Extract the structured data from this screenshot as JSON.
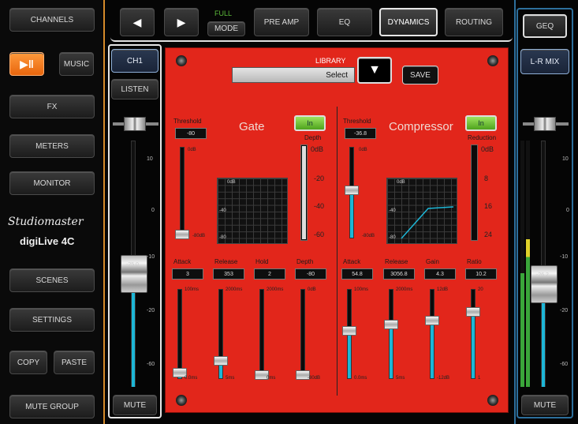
{
  "left_nav": {
    "channels": "CHANNELS",
    "music": "MUSIC",
    "fx": "FX",
    "meters": "METERS",
    "monitor": "MONITOR",
    "brand": "Studiomaster",
    "model": "digiLive 4C",
    "scenes": "SCENES",
    "settings": "SETTINGS",
    "copy": "COPY",
    "paste": "PASTE",
    "mute_group": "MUTE GROUP"
  },
  "top_bar": {
    "full": "FULL",
    "mode": "MODE",
    "tabs": [
      "PRE AMP",
      "EQ",
      "DYNAMICS",
      "ROUTING"
    ],
    "selected_tab": "DYNAMICS"
  },
  "channel_strip": {
    "channel": "CH1",
    "listen": "LISTEN",
    "fader_value": "-25.0",
    "scale": [
      "10",
      "0",
      "-10",
      "-20",
      "-60"
    ],
    "mute": "MUTE",
    "level": 0.45
  },
  "right_strip": {
    "geq": "GEQ",
    "bus": "L-R MIX",
    "fader_value": "-26.2",
    "scale": [
      "10",
      "0",
      "-10",
      "-20",
      "-60"
    ],
    "mute": "MUTE",
    "level": 0.4
  },
  "library": {
    "label": "LIBRARY",
    "select": "Select",
    "save": "SAVE"
  },
  "gate": {
    "title": "Gate",
    "in_label": "In",
    "threshold_label": "Threshold",
    "threshold_value": "-80",
    "threshold_top": "0dB",
    "threshold_bottom": "-80dB",
    "threshold_level": 0.0,
    "depth_label": "Depth",
    "depth_scale": [
      "0dB",
      "-20",
      "-40",
      "-60"
    ],
    "depth_level": 1.0,
    "graph_top": "0dB",
    "graph_mid": "-40",
    "graph_bottom": "-80",
    "knobs": [
      {
        "label": "Attack",
        "value": "3",
        "top": "100ms",
        "bottom": "0.0ms",
        "level": 0.03
      },
      {
        "label": "Release",
        "value": "353",
        "top": "2000ms",
        "bottom": "5ms",
        "level": 0.18
      },
      {
        "label": "Hold",
        "value": "2",
        "top": "2000ms",
        "bottom": "0ms",
        "level": 0.0
      },
      {
        "label": "Depth",
        "value": "-80",
        "top": "0dB",
        "bottom": "-80dB",
        "level": 0.0
      }
    ]
  },
  "compressor": {
    "title": "Compressor",
    "in_label": "In",
    "threshold_label": "Threshold",
    "threshold_value": "-36.8",
    "threshold_top": "0dB",
    "threshold_bottom": "-80dB",
    "threshold_level": 0.54,
    "reduction_label": "Reduction",
    "reduction_scale": [
      "0dB",
      "8",
      "16",
      "24"
    ],
    "graph_top": "0dB",
    "graph_mid": "-40",
    "graph_bottom": "-80",
    "knobs": [
      {
        "label": "Attack",
        "value": "54.8",
        "top": "100ms",
        "bottom": "0.0ms",
        "level": 0.55
      },
      {
        "label": "Release",
        "value": "3056.8",
        "top": "2000ms",
        "bottom": "5ms",
        "level": 0.63
      },
      {
        "label": "Gain",
        "value": "4.3",
        "top": "12dB",
        "bottom": "-12dB",
        "level": 0.68
      },
      {
        "label": "Ratio",
        "value": "10.2",
        "top": "20",
        "bottom": "1",
        "level": 0.78
      }
    ]
  },
  "colors": {
    "panel_red": "#e2261b",
    "accent_cyan": "#1db6d6",
    "in_green": "#7bcf3c",
    "play_orange": "#f07a18"
  }
}
